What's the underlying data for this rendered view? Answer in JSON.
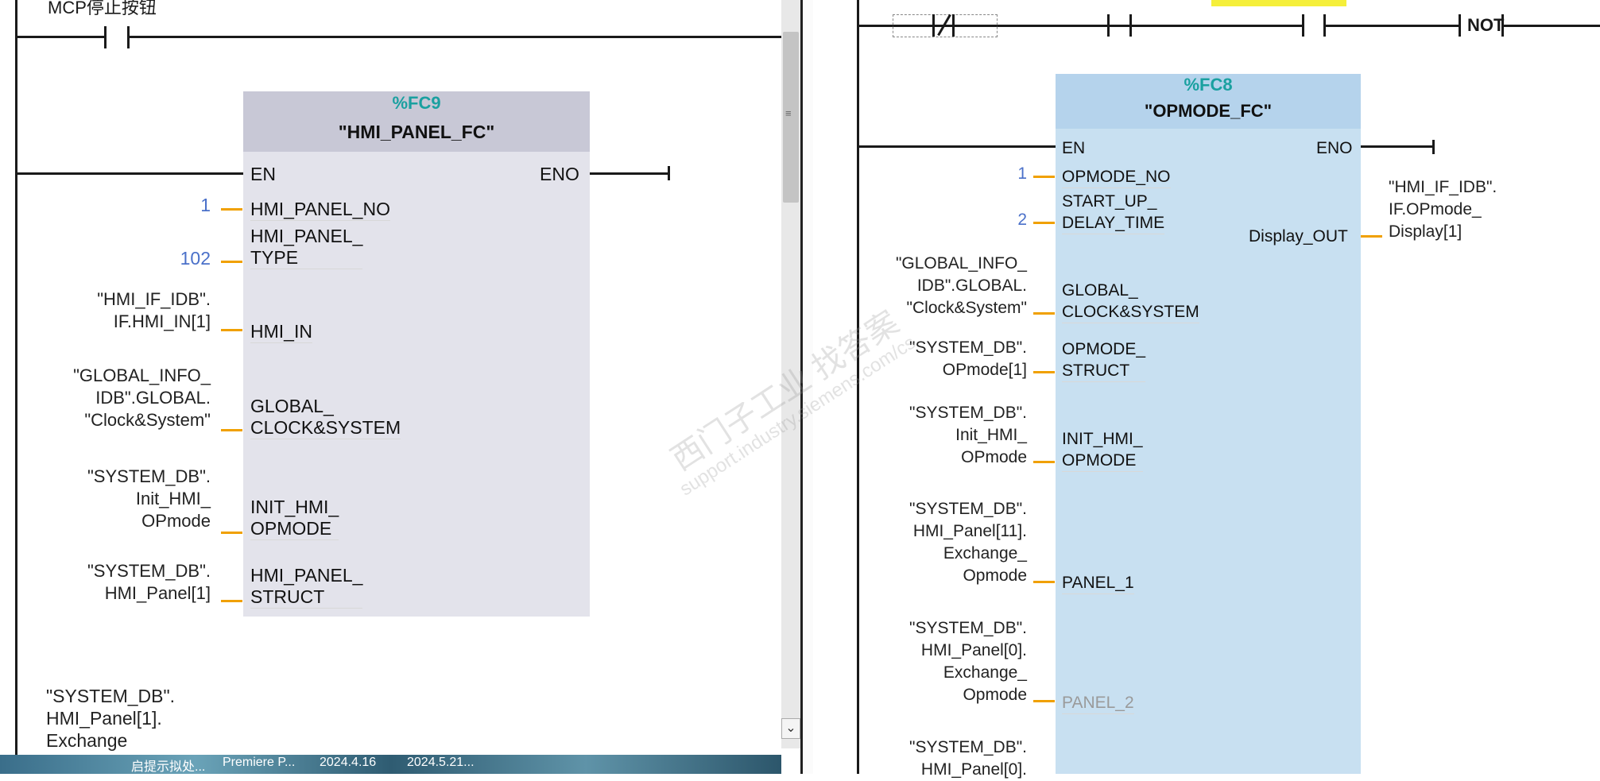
{
  "left_network": {
    "top_contact_label": "MCP停止按钮",
    "block": {
      "number": "%FC9",
      "name": "\"HMI_PANEL_FC\"",
      "pins_in": [
        {
          "pin": "EN",
          "value": ""
        },
        {
          "pin": "HMI_PANEL_NO",
          "value": "1"
        },
        {
          "pin": "HMI_PANEL_\nTYPE",
          "value": "102"
        },
        {
          "pin": "HMI_IN",
          "value": "\"HMI_IF_IDB\".\nIF.HMI_IN[1]"
        },
        {
          "pin": "GLOBAL_\nCLOCK&SYSTEM",
          "value": "\"GLOBAL_INFO_\nIDB\".GLOBAL.\n\"Clock&System\""
        },
        {
          "pin": "INIT_HMI_\nOPMODE",
          "value": "\"SYSTEM_DB\".\nInit_HMI_\nOPmode"
        },
        {
          "pin": "HMI_PANEL_\nSTRUCT",
          "value": "\"SYSTEM_DB\".\nHMI_Panel[1]"
        }
      ],
      "pin_out": "ENO"
    },
    "bottom_operand": "\"SYSTEM_DB\".\nHMI_Panel[1].\nExchange"
  },
  "right_network": {
    "top_label": "...",
    "not_label": "NOT",
    "block": {
      "number": "%FC8",
      "name": "\"OPMODE_FC\"",
      "pins_in": [
        {
          "pin": "EN",
          "value": ""
        },
        {
          "pin": "OPMODE_NO",
          "value": "1"
        },
        {
          "pin": "START_UP_\nDELAY_TIME",
          "value": "2"
        },
        {
          "pin": "GLOBAL_\nCLOCK&SYSTEM",
          "value": "\"GLOBAL_INFO_\nIDB\".GLOBAL.\n\"Clock&System\""
        },
        {
          "pin": "OPMODE_\nSTRUCT",
          "value": "\"SYSTEM_DB\".\nOPmode[1]"
        },
        {
          "pin": "INIT_HMI_\nOPMODE",
          "value": "\"SYSTEM_DB\".\nInit_HMI_\nOPmode"
        },
        {
          "pin": "PANEL_1",
          "value": "\"SYSTEM_DB\".\nHMI_Panel[11].\nExchange_\nOpmode"
        },
        {
          "pin": "PANEL_2",
          "value": "\"SYSTEM_DB\".\nHMI_Panel[0].\nExchange_\nOpmode"
        },
        {
          "pin": "",
          "value": "\"SYSTEM_DB\".\nHMI_Panel[0]."
        }
      ],
      "pins_out": [
        {
          "pin": "ENO",
          "value": ""
        },
        {
          "pin": "Display_OUT",
          "value": "\"HMI_IF_IDB\".\nIF.OPmode_\nDisplay[1]"
        }
      ]
    }
  },
  "watermark": {
    "line1": "西门子工业  找答案",
    "line2": "support.industry.siemens.com/cs"
  },
  "taskbar": {
    "items": [
      "启提示拟处...",
      "Premiere P...",
      "2024.4.16",
      "2024.5.21..."
    ]
  },
  "colors": {
    "wire": "#f0a000",
    "fc_number": "#1aa0a0",
    "left_block": "#e3e3eb",
    "right_block": "#c8e0f1",
    "value_blue": "#4a70c9",
    "yellow_tag": "#f5ef3a"
  }
}
